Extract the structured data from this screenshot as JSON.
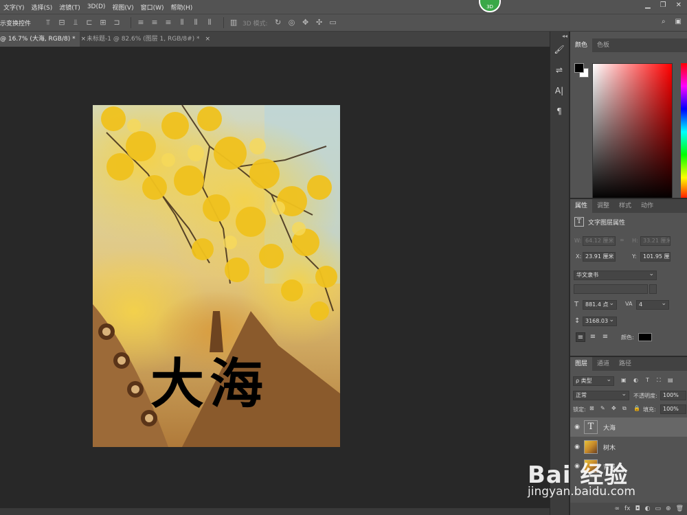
{
  "menu": [
    "文字(Y)",
    "选择(S)",
    "滤镜(T)",
    "3D(D)",
    "视图(V)",
    "窗口(W)",
    "帮助(H)"
  ],
  "badge": "3D",
  "options": {
    "transform_label": "示变换控件",
    "mode3d_label": "3D 模式:"
  },
  "tabs": [
    {
      "label": "@ 16.7% (大海, RGB/8) *",
      "close": "×"
    },
    {
      "label": "未标题-1 @ 82.6% (图层 1, RGB/8#) *",
      "close": "×"
    }
  ],
  "document": {
    "headline": "大海"
  },
  "color_panel": {
    "tabs": [
      "颜色",
      "色板"
    ],
    "foreground": "#000000",
    "background": "#ffffff"
  },
  "properties": {
    "tabs": [
      "属性",
      "调整",
      "样式",
      "动作"
    ],
    "title": "文字图层属性",
    "w_label": "W:",
    "w_value": "64.12 厘米",
    "link_icon": "∞",
    "h_label": "H:",
    "h_value": "33.21 厘米",
    "x_label": "X:",
    "x_value": "23.91 厘米",
    "y_label": "Y:",
    "y_value": "101.95 厘米",
    "font_family": "华文隶书",
    "font_size": "881.4 点",
    "tracking": "4",
    "leading": "3168.03",
    "color_label": "颜色:",
    "text_color": "#000000"
  },
  "layers_panel": {
    "tabs": [
      "图层",
      "通道",
      "路径"
    ],
    "filter_label": "ρ 类型",
    "blend_mode": "正常",
    "opacity_label": "不透明度:",
    "opacity_value": "100%",
    "lock_label": "锁定:",
    "fill_label": "填充:",
    "fill_value": "100%",
    "layers": [
      {
        "name": "大海",
        "thumb": "T"
      },
      {
        "name": "树木",
        "thumb": ""
      },
      {
        "name": "背景",
        "thumb": ""
      }
    ]
  },
  "watermark": {
    "brand": "Bai 经验",
    "url": "jingyan.baidu.com"
  }
}
